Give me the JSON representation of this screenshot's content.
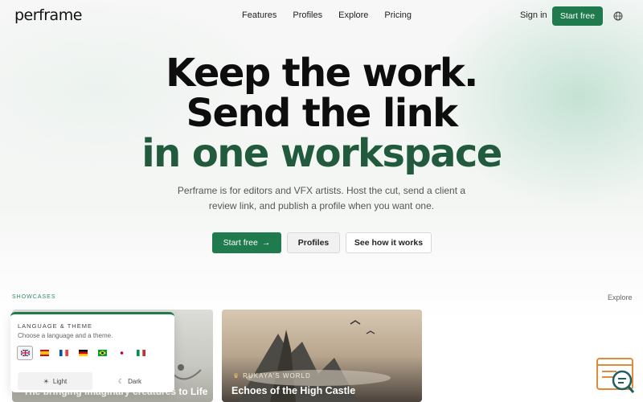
{
  "nav": {
    "logo": "perframe",
    "links": [
      "Features",
      "Profiles",
      "Explore",
      "Pricing"
    ],
    "signin": "Sign in",
    "start": "Start free",
    "globe_icon": "globe-icon"
  },
  "hero": {
    "line1": "Keep the work.",
    "line2": "Send the link",
    "line3": "in one workspace",
    "subtitle": "Perframe is for editors and VFX artists. Host the cut, send a client a review link, and publish a profile when you want one."
  },
  "cta": {
    "primary": "Start free",
    "profiles": "Profiles",
    "how": "See how it works"
  },
  "showcases": {
    "label": "SHOWCASES",
    "explore": "Explore",
    "cards": [
      {
        "title": "The bringing imaginary creatures to Life"
      },
      {
        "brand": "RUKAYA'S WORLD",
        "title": "Echoes of the High Castle"
      }
    ]
  },
  "language_popover": {
    "title": "LANGUAGE & THEME",
    "subtitle": "Choose a language and a theme.",
    "flags": [
      "en",
      "es",
      "fr",
      "de",
      "pt-BR",
      "ja",
      "it"
    ],
    "selected_flag": "en",
    "themes": [
      "Light",
      "Dark"
    ],
    "selected_theme": "Light"
  },
  "colors": {
    "accent": "#1f7a4d",
    "hero_green": "#215a3c"
  }
}
